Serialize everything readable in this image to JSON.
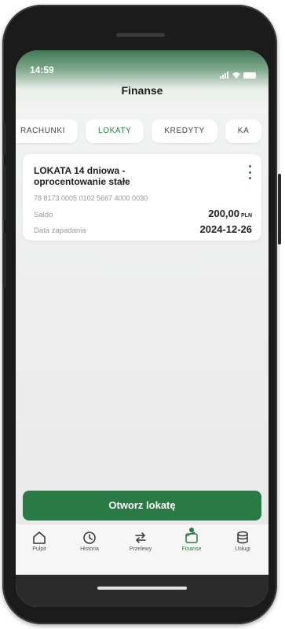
{
  "status_bar": {
    "time": "14:59"
  },
  "header": {
    "title": "Finanse"
  },
  "tabs": [
    {
      "label": "RACHUNKI",
      "active": false
    },
    {
      "label": "LOKATY",
      "active": true
    },
    {
      "label": "KREDYTY",
      "active": false
    },
    {
      "label": "KA",
      "active": false
    }
  ],
  "deposit": {
    "name_line1": "LOKATA 14 dniowa -",
    "name_line2": "oprocentowanie stałe",
    "account_number": "78 8173 0005 0102 5667 4000 0030",
    "balance_label": "Saldo",
    "balance_value": "200,00",
    "balance_currency": "PLN",
    "maturity_label": "Data zapadania",
    "maturity_value": "2024-12-26"
  },
  "primary_action": {
    "label": "Otworz lokatę"
  },
  "bottom_nav": [
    {
      "label": "Pulpit",
      "icon": "home-icon",
      "active": false
    },
    {
      "label": "Historia",
      "icon": "history-icon",
      "active": false
    },
    {
      "label": "Przelewy",
      "icon": "transfer-icon",
      "active": false
    },
    {
      "label": "Finanse",
      "icon": "wallet-icon",
      "active": true
    },
    {
      "label": "Usługi",
      "icon": "services-icon",
      "active": false
    }
  ],
  "colors": {
    "brand_green": "#2a7a45",
    "background": "#efefef",
    "card": "#ffffff"
  }
}
